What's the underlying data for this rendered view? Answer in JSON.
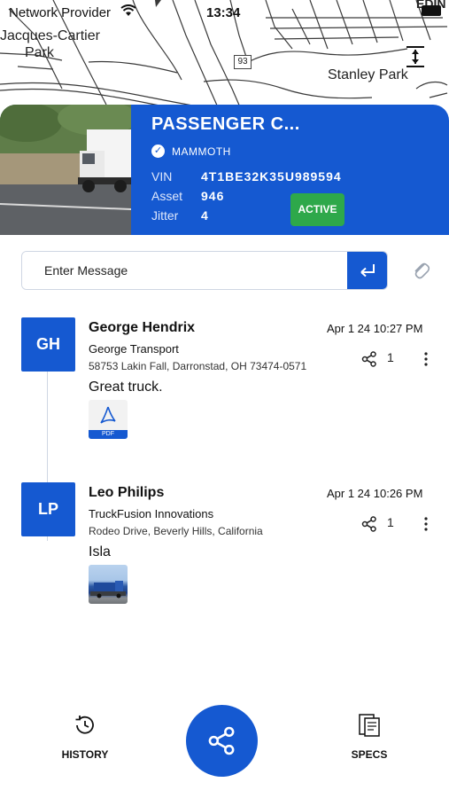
{
  "status_bar": {
    "carrier": "Network Provider",
    "time": "13:34"
  },
  "map": {
    "labels": {
      "jacques_cartier_line1": "Jacques-Cartier",
      "jacques_cartier_line2": "Park",
      "stanley_park": "Stanley Park",
      "edin": "EDIN",
      "road_tag": "93"
    }
  },
  "vehicle": {
    "title": "PASSENGER C...",
    "make": "MAMMOTH",
    "vin_label": "VIN",
    "vin": "4T1BE32K35U989594",
    "asset_label": "Asset",
    "asset": "946",
    "jitter_label": "Jitter",
    "jitter": "4",
    "status": "ACTIVE",
    "status_color": "#2ea84a",
    "accent": "#1559d1"
  },
  "composer": {
    "placeholder": "Enter Message",
    "send_icon": "return-arrow-icon",
    "attach_icon": "paperclip-icon"
  },
  "feed": [
    {
      "initials": "GH",
      "author": "George Hendrix",
      "company": "George Transport",
      "address": "58753 Lakin Fall, Darronstad, OH 73474-0571",
      "date": "Apr 1 24  10:27 PM",
      "share_count": "1",
      "message": "Great truck.",
      "attachment_type": "pdf",
      "attachment_label": "PDF"
    },
    {
      "initials": "LP",
      "author": "Leo Philips",
      "company": "TruckFusion Innovations",
      "address": "Rodeo Drive, Beverly Hills, California",
      "date": "Apr 1 24  10:26 PM",
      "share_count": "1",
      "message": "Isla",
      "attachment_type": "image"
    }
  ],
  "bottom_nav": {
    "history": "HISTORY",
    "specs": "SPECS",
    "center_icon": "share-icon"
  }
}
